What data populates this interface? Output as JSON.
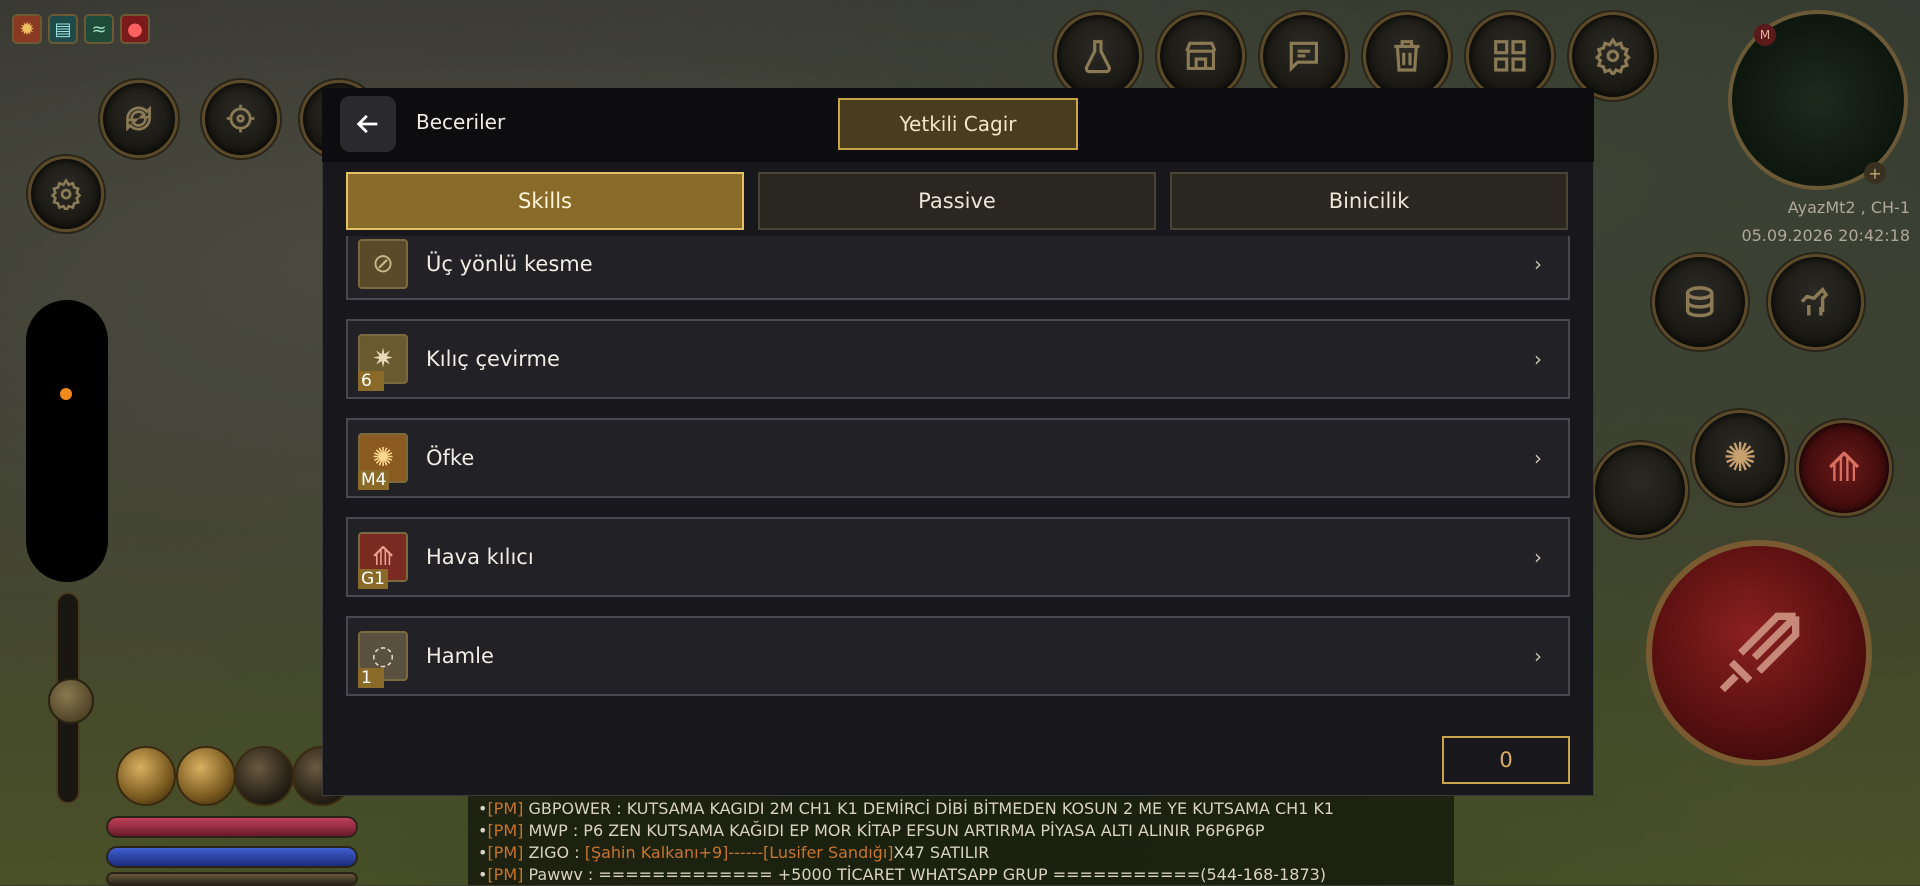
{
  "modal": {
    "title": "Beceriler",
    "call_button": "Yetkili Cagir",
    "tabs": [
      {
        "label": "Skills",
        "active": true
      },
      {
        "label": "Passive",
        "active": false
      },
      {
        "label": "Binicilik",
        "active": false
      }
    ],
    "skills": [
      {
        "name": "Üç yönlü kesme",
        "level": "",
        "icon": "triple-slash-icon"
      },
      {
        "name": "Kılıç çevirme",
        "level": "6",
        "icon": "sword-spin-icon"
      },
      {
        "name": "Öfke",
        "level": "M4",
        "icon": "rage-icon"
      },
      {
        "name": "Hava kılıcı",
        "level": "G1",
        "icon": "air-sword-icon"
      },
      {
        "name": "Hamle",
        "level": "1",
        "icon": "charge-icon"
      }
    ],
    "skill_points": "0"
  },
  "hud": {
    "server": "AyazMt2 , CH-1",
    "datetime": "05.09.2026 20:42:18",
    "minimap_marker": "M"
  },
  "chat": [
    {
      "prefix": "[PM]",
      "text": " GBPOWER : KUTSAMA KAGIDI 2M CH1 K1 DEMİRCİ DİBİ BİTMEDEN KOSUN 2 ME YE KUTSAMA CH1 K1"
    },
    {
      "prefix": "[PM]",
      "text": " MWP : P6 ZEN KUTSAMA KAĞIDI EP MOR KİTAP EFSUN ARTIRMA PİYASA ALTI ALINIR P6P6P6P"
    },
    {
      "prefix": "[PM]",
      "text": " ZIGO : ",
      "hl": "[Şahin Kalkanı+9]------[Lusifer Sandığı]",
      "tail": "X47 SATILIR"
    },
    {
      "prefix": "[PM]",
      "text": " Pawwv : ============= +5000 TİCARET WHATSAPP GRUP ===========(544-168-1873)"
    }
  ],
  "colors": {
    "accent_gold": "#c9a54a",
    "active_tab": "#8a6a28",
    "panel_bg": "#18181c"
  }
}
